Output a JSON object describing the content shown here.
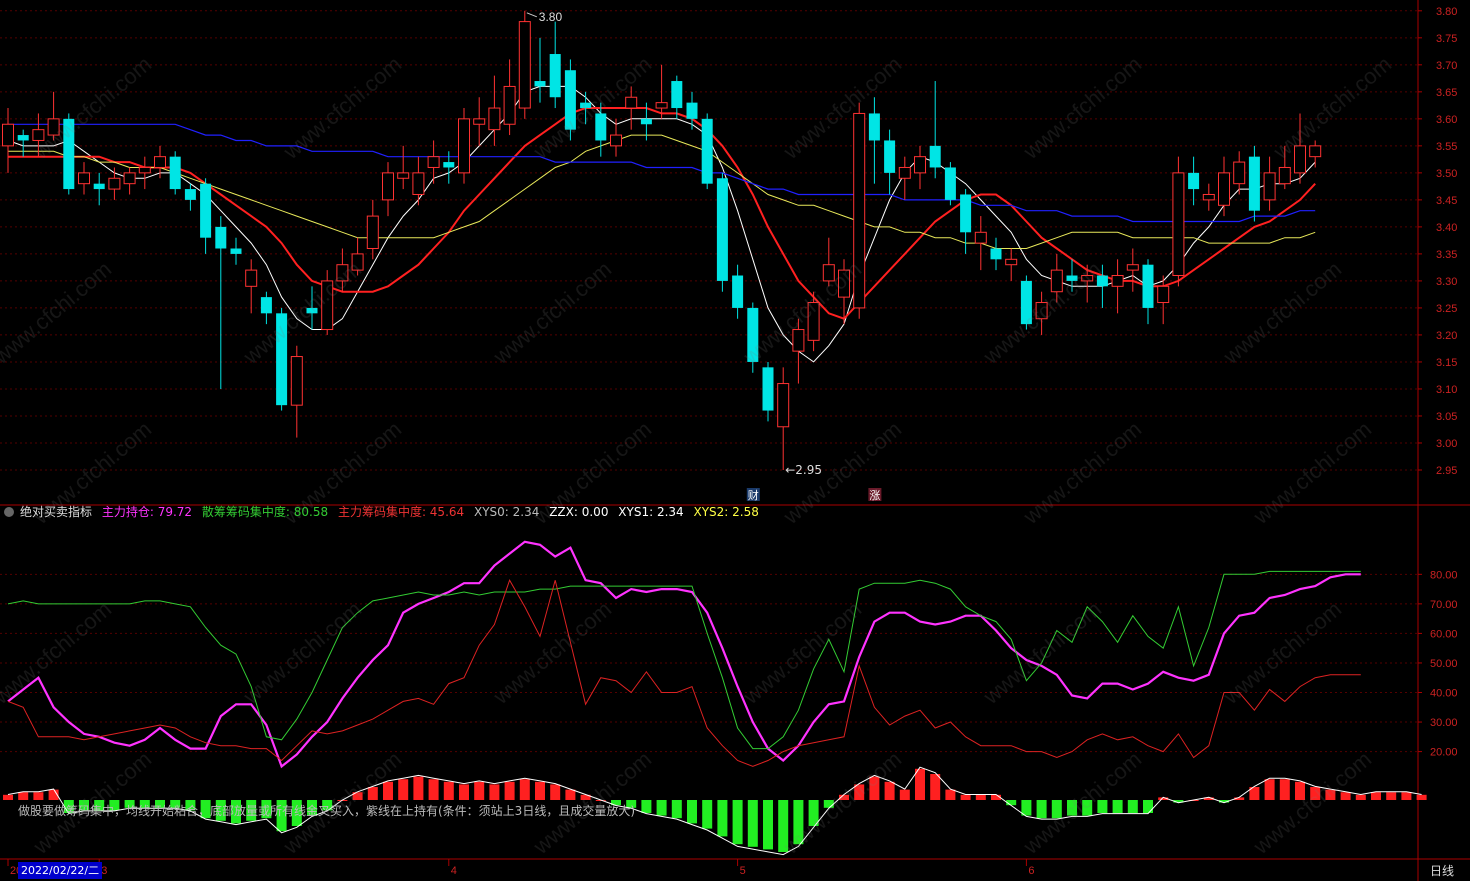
{
  "colors": {
    "up": "#ff3232",
    "down": "#00e5e5",
    "ma5": "#ffffff",
    "ma10": "#ff2020",
    "ma20": "#e8e85a",
    "ma60": "#2020ff",
    "main_hold": "#ff33ff",
    "retail": "#33cc33",
    "main_chip": "#dd2222",
    "xys2": "#ffff44",
    "axis": "#aa0000"
  },
  "price_axis": {
    "ticks": [
      "3.80",
      "3.75",
      "3.70",
      "3.65",
      "3.60",
      "3.55",
      "3.50",
      "3.45",
      "3.40",
      "3.35",
      "3.30",
      "3.25",
      "3.20",
      "3.15",
      "3.10",
      "3.05",
      "3.00",
      "2.95"
    ],
    "min": 2.9,
    "max": 3.82
  },
  "ind_axis": {
    "ticks": [
      "80.00",
      "70.00",
      "60.00",
      "50.00",
      "40.00",
      "30.00",
      "20.00"
    ],
    "min": 7,
    "max": 95
  },
  "x_axis": {
    "labels": [
      {
        "text": "20",
        "bar": 0
      },
      {
        "text": "3",
        "bar": 6
      },
      {
        "text": "4",
        "bar": 29
      },
      {
        "text": "5",
        "bar": 48
      },
      {
        "text": "6",
        "bar": 67
      }
    ]
  },
  "annotations": {
    "high_label": "3.80",
    "low_label": "2.95",
    "cai": "财",
    "zhang": "涨"
  },
  "indicator": {
    "name": "绝对买卖指标",
    "items": [
      {
        "label": "主力持仓: ",
        "value": "79.72",
        "color": "#ff33ff"
      },
      {
        "label": "散筹筹码集中度: ",
        "value": "80.58",
        "color": "#33cc33"
      },
      {
        "label": "主力筹码集中度: ",
        "value": "45.64",
        "color": "#dd2222"
      },
      {
        "label": "XYS0: ",
        "value": "2.34",
        "color": "#bbbbbb"
      },
      {
        "label": "ZZX: ",
        "value": "0.00",
        "color": "#ffffff"
      },
      {
        "label": "XYS1: ",
        "value": "2.34",
        "color": "#ffffff"
      },
      {
        "label": "XYS2: ",
        "value": "2.58",
        "color": "#ffff44"
      }
    ]
  },
  "hint_text": "做股要做筹码集中，均线开始粘合，底部放量或所有线金叉买入，紫线在上持有(条件：须站上3日线，且成交量放大)",
  "watermark": "www.cfchi.com",
  "date_badge": "2022/02/22/二",
  "period_label": "日线",
  "chart_data": {
    "type": "candlestick",
    "candles": [
      [
        3.55,
        3.59,
        3.62,
        3.5
      ],
      [
        3.57,
        3.56,
        3.58,
        3.53
      ],
      [
        3.56,
        3.58,
        3.61,
        3.53
      ],
      [
        3.57,
        3.6,
        3.65,
        3.56
      ],
      [
        3.6,
        3.47,
        3.61,
        3.46
      ],
      [
        3.48,
        3.5,
        3.52,
        3.46
      ],
      [
        3.48,
        3.47,
        3.5,
        3.44
      ],
      [
        3.47,
        3.49,
        3.51,
        3.45
      ],
      [
        3.48,
        3.5,
        3.51,
        3.46
      ],
      [
        3.5,
        3.51,
        3.53,
        3.47
      ],
      [
        3.51,
        3.53,
        3.55,
        3.49
      ],
      [
        3.53,
        3.47,
        3.54,
        3.46
      ],
      [
        3.47,
        3.45,
        3.48,
        3.43
      ],
      [
        3.48,
        3.38,
        3.49,
        3.35
      ],
      [
        3.4,
        3.36,
        3.42,
        3.1
      ],
      [
        3.36,
        3.35,
        3.38,
        3.33
      ],
      [
        3.29,
        3.32,
        3.34,
        3.24
      ],
      [
        3.27,
        3.24,
        3.28,
        3.22
      ],
      [
        3.24,
        3.07,
        3.25,
        3.06
      ],
      [
        3.07,
        3.16,
        3.18,
        3.01
      ],
      [
        3.25,
        3.24,
        3.29,
        3.21
      ],
      [
        3.21,
        3.3,
        3.32,
        3.2
      ],
      [
        3.3,
        3.33,
        3.36,
        3.28
      ],
      [
        3.32,
        3.35,
        3.38,
        3.31
      ],
      [
        3.36,
        3.42,
        3.45,
        3.34
      ],
      [
        3.45,
        3.5,
        3.52,
        3.42
      ],
      [
        3.49,
        3.5,
        3.55,
        3.47
      ],
      [
        3.46,
        3.5,
        3.53,
        3.44
      ],
      [
        3.51,
        3.53,
        3.56,
        3.48
      ],
      [
        3.52,
        3.51,
        3.54,
        3.48
      ],
      [
        3.5,
        3.6,
        3.62,
        3.48
      ],
      [
        3.59,
        3.6,
        3.64,
        3.55
      ],
      [
        3.58,
        3.62,
        3.68,
        3.55
      ],
      [
        3.59,
        3.66,
        3.71,
        3.57
      ],
      [
        3.62,
        3.78,
        3.8,
        3.6
      ],
      [
        3.67,
        3.66,
        3.75,
        3.63
      ],
      [
        3.72,
        3.64,
        3.78,
        3.62
      ],
      [
        3.69,
        3.58,
        3.71,
        3.56
      ],
      [
        3.63,
        3.62,
        3.65,
        3.59
      ],
      [
        3.61,
        3.56,
        3.63,
        3.53
      ],
      [
        3.55,
        3.57,
        3.6,
        3.53
      ],
      [
        3.62,
        3.64,
        3.66,
        3.58
      ],
      [
        3.6,
        3.59,
        3.63,
        3.56
      ],
      [
        3.62,
        3.63,
        3.7,
        3.6
      ],
      [
        3.67,
        3.62,
        3.68,
        3.6
      ],
      [
        3.63,
        3.6,
        3.65,
        3.58
      ],
      [
        3.6,
        3.48,
        3.61,
        3.47
      ],
      [
        3.49,
        3.3,
        3.5,
        3.28
      ],
      [
        3.31,
        3.25,
        3.33,
        3.23
      ],
      [
        3.25,
        3.15,
        3.26,
        3.13
      ],
      [
        3.14,
        3.06,
        3.15,
        3.04
      ],
      [
        3.03,
        3.11,
        3.14,
        2.95
      ],
      [
        3.17,
        3.21,
        3.23,
        3.11
      ],
      [
        3.19,
        3.26,
        3.28,
        3.17
      ],
      [
        3.3,
        3.33,
        3.38,
        3.29
      ],
      [
        3.27,
        3.32,
        3.34,
        3.22
      ],
      [
        3.25,
        3.61,
        3.63,
        3.23
      ],
      [
        3.61,
        3.56,
        3.64,
        3.48
      ],
      [
        3.56,
        3.5,
        3.58,
        3.46
      ],
      [
        3.49,
        3.51,
        3.53,
        3.45
      ],
      [
        3.5,
        3.53,
        3.55,
        3.47
      ],
      [
        3.55,
        3.51,
        3.67,
        3.49
      ],
      [
        3.51,
        3.45,
        3.52,
        3.44
      ],
      [
        3.46,
        3.39,
        3.47,
        3.35
      ],
      [
        3.37,
        3.39,
        3.42,
        3.32
      ],
      [
        3.36,
        3.34,
        3.38,
        3.32
      ],
      [
        3.33,
        3.34,
        3.36,
        3.3
      ],
      [
        3.3,
        3.22,
        3.31,
        3.21
      ],
      [
        3.23,
        3.26,
        3.28,
        3.2
      ],
      [
        3.28,
        3.32,
        3.35,
        3.26
      ],
      [
        3.31,
        3.3,
        3.34,
        3.28
      ],
      [
        3.3,
        3.31,
        3.33,
        3.26
      ],
      [
        3.31,
        3.29,
        3.33,
        3.25
      ],
      [
        3.29,
        3.31,
        3.34,
        3.24
      ],
      [
        3.32,
        3.33,
        3.36,
        3.28
      ],
      [
        3.33,
        3.25,
        3.34,
        3.22
      ],
      [
        3.26,
        3.29,
        3.31,
        3.22
      ],
      [
        3.31,
        3.5,
        3.53,
        3.29
      ],
      [
        3.5,
        3.47,
        3.53,
        3.44
      ],
      [
        3.45,
        3.46,
        3.48,
        3.43
      ],
      [
        3.44,
        3.5,
        3.53,
        3.42
      ],
      [
        3.48,
        3.52,
        3.54,
        3.46
      ],
      [
        3.53,
        3.43,
        3.55,
        3.41
      ],
      [
        3.45,
        3.5,
        3.53,
        3.43
      ],
      [
        3.48,
        3.51,
        3.55,
        3.47
      ],
      [
        3.5,
        3.55,
        3.61,
        3.48
      ],
      [
        3.53,
        3.55,
        3.56,
        3.51
      ]
    ],
    "ma_series": [
      {
        "name": "MA5",
        "values": [
          3.56,
          3.55,
          3.55,
          3.55,
          3.56,
          3.54,
          3.52,
          3.5,
          3.49,
          3.49,
          3.5,
          3.5,
          3.48,
          3.46,
          3.43,
          3.4,
          3.37,
          3.33,
          3.27,
          3.23,
          3.21,
          3.21,
          3.23,
          3.28,
          3.33,
          3.38,
          3.42,
          3.45,
          3.49,
          3.5,
          3.52,
          3.55,
          3.58,
          3.61,
          3.65,
          3.66,
          3.66,
          3.66,
          3.64,
          3.61,
          3.59,
          3.6,
          3.6,
          3.6,
          3.6,
          3.59,
          3.57,
          3.51,
          3.43,
          3.34,
          3.25,
          3.2,
          3.17,
          3.15,
          3.18,
          3.22,
          3.31,
          3.38,
          3.45,
          3.5,
          3.53,
          3.52,
          3.5,
          3.48,
          3.45,
          3.42,
          3.39,
          3.34,
          3.31,
          3.3,
          3.29,
          3.29,
          3.29,
          3.3,
          3.31,
          3.29,
          3.3,
          3.33,
          3.37,
          3.4,
          3.44,
          3.47,
          3.47,
          3.48,
          3.48,
          3.49,
          3.52
        ]
      },
      {
        "name": "MA10",
        "values": [
          3.53,
          3.53,
          3.53,
          3.53,
          3.53,
          3.53,
          3.53,
          3.52,
          3.52,
          3.51,
          3.51,
          3.51,
          3.5,
          3.48,
          3.46,
          3.44,
          3.42,
          3.4,
          3.37,
          3.33,
          3.3,
          3.29,
          3.28,
          3.28,
          3.28,
          3.29,
          3.31,
          3.33,
          3.36,
          3.39,
          3.43,
          3.46,
          3.49,
          3.52,
          3.55,
          3.57,
          3.59,
          3.61,
          3.62,
          3.62,
          3.62,
          3.62,
          3.62,
          3.61,
          3.61,
          3.6,
          3.58,
          3.55,
          3.51,
          3.46,
          3.4,
          3.35,
          3.3,
          3.27,
          3.24,
          3.23,
          3.26,
          3.29,
          3.32,
          3.35,
          3.38,
          3.41,
          3.43,
          3.45,
          3.46,
          3.46,
          3.44,
          3.41,
          3.38,
          3.36,
          3.34,
          3.32,
          3.31,
          3.3,
          3.3,
          3.29,
          3.29,
          3.3,
          3.32,
          3.34,
          3.36,
          3.38,
          3.4,
          3.41,
          3.43,
          3.45,
          3.48
        ]
      },
      {
        "name": "MA20",
        "values": [
          3.54,
          3.54,
          3.54,
          3.54,
          3.53,
          3.53,
          3.52,
          3.52,
          3.51,
          3.51,
          3.51,
          3.5,
          3.49,
          3.48,
          3.47,
          3.46,
          3.45,
          3.44,
          3.43,
          3.42,
          3.41,
          3.4,
          3.39,
          3.38,
          3.38,
          3.38,
          3.38,
          3.38,
          3.38,
          3.39,
          3.4,
          3.41,
          3.43,
          3.45,
          3.47,
          3.49,
          3.51,
          3.52,
          3.54,
          3.55,
          3.56,
          3.57,
          3.57,
          3.57,
          3.56,
          3.55,
          3.54,
          3.52,
          3.5,
          3.48,
          3.46,
          3.45,
          3.44,
          3.44,
          3.43,
          3.42,
          3.41,
          3.4,
          3.4,
          3.39,
          3.39,
          3.38,
          3.38,
          3.37,
          3.37,
          3.36,
          3.36,
          3.36,
          3.37,
          3.38,
          3.39,
          3.39,
          3.39,
          3.39,
          3.38,
          3.38,
          3.38,
          3.38,
          3.38,
          3.37,
          3.37,
          3.37,
          3.37,
          3.37,
          3.38,
          3.38,
          3.39
        ]
      },
      {
        "name": "MA60",
        "values": [
          3.59,
          3.59,
          3.59,
          3.59,
          3.59,
          3.59,
          3.59,
          3.59,
          3.59,
          3.59,
          3.59,
          3.59,
          3.58,
          3.57,
          3.57,
          3.56,
          3.56,
          3.55,
          3.55,
          3.55,
          3.54,
          3.54,
          3.54,
          3.54,
          3.54,
          3.53,
          3.53,
          3.53,
          3.53,
          3.53,
          3.53,
          3.53,
          3.53,
          3.53,
          3.53,
          3.53,
          3.52,
          3.52,
          3.52,
          3.52,
          3.52,
          3.52,
          3.51,
          3.51,
          3.51,
          3.51,
          3.5,
          3.5,
          3.49,
          3.48,
          3.47,
          3.47,
          3.46,
          3.46,
          3.46,
          3.46,
          3.46,
          3.46,
          3.46,
          3.45,
          3.45,
          3.45,
          3.45,
          3.45,
          3.44,
          3.44,
          3.44,
          3.43,
          3.43,
          3.43,
          3.42,
          3.42,
          3.42,
          3.42,
          3.41,
          3.41,
          3.41,
          3.41,
          3.41,
          3.41,
          3.41,
          3.41,
          3.42,
          3.42,
          3.42,
          3.43,
          3.43
        ]
      }
    ],
    "indicator_series": [
      {
        "name": "主力持仓",
        "values": [
          37,
          41,
          45,
          35,
          30,
          26,
          25,
          23,
          22,
          24,
          28,
          24,
          21,
          21,
          32,
          36,
          36,
          29,
          15,
          19,
          25,
          30,
          38,
          45,
          51,
          56,
          67,
          70,
          72,
          74,
          77,
          77,
          83,
          87,
          91,
          90,
          86,
          89,
          78,
          77,
          72,
          75,
          74,
          75,
          75,
          74,
          67,
          55,
          42,
          30,
          21,
          17,
          22,
          30,
          36,
          37,
          52,
          64,
          67,
          67,
          64,
          63,
          64,
          66,
          66,
          61,
          55,
          51,
          49,
          46,
          39,
          38,
          43,
          43,
          41,
          43,
          47,
          45,
          44,
          46,
          60,
          66,
          67,
          72,
          73,
          75,
          76,
          79,
          80,
          80
        ]
      },
      {
        "name": "散筹筹码集中度",
        "values": [
          70,
          71,
          70,
          70,
          70,
          70,
          70,
          70,
          70,
          71,
          71,
          70,
          69,
          62,
          56,
          53,
          42,
          25,
          24,
          31,
          40,
          51,
          62,
          67,
          71,
          72,
          73,
          74,
          73,
          73,
          74,
          73,
          74,
          74,
          74,
          75,
          75,
          76,
          76,
          76,
          76,
          76,
          76,
          76,
          76,
          76,
          60,
          45,
          28,
          21,
          21,
          25,
          34,
          48,
          58,
          47,
          75,
          77,
          77,
          77,
          78,
          77,
          75,
          69,
          66,
          64,
          58,
          44,
          50,
          61,
          57,
          69,
          64,
          57,
          66,
          59,
          55,
          69,
          49,
          62,
          80,
          80,
          80,
          81,
          81,
          81,
          81,
          81,
          81,
          81
        ]
      },
      {
        "name": "主力筹码集中度",
        "values": [
          37,
          35,
          25,
          25,
          25,
          24,
          25,
          26,
          27,
          28,
          29,
          28,
          25,
          23,
          22,
          22,
          21,
          21,
          17,
          22,
          27,
          26,
          27,
          29,
          31,
          34,
          37,
          38,
          36,
          43,
          45,
          56,
          63,
          78,
          69,
          59,
          78,
          57,
          36,
          45,
          44,
          40,
          47,
          40,
          40,
          42,
          28,
          22,
          17,
          15,
          17,
          20,
          22,
          23,
          24,
          25,
          49,
          35,
          29,
          32,
          34,
          28,
          30,
          25,
          22,
          22,
          22,
          20,
          20,
          18,
          20,
          24,
          26,
          24,
          25,
          22,
          20,
          26,
          18,
          22,
          40,
          40,
          34,
          41,
          37,
          42,
          45,
          46,
          46,
          46
        ]
      }
    ],
    "histogram": [
      2,
      3,
      3,
      4,
      -5,
      -4,
      -4,
      -4,
      -3,
      -3,
      -3,
      -3,
      -4,
      -7,
      -8,
      -9,
      -8,
      -7,
      -12,
      -10,
      -6,
      -4,
      0,
      3,
      5,
      7,
      8,
      9,
      8,
      7,
      6,
      7,
      6,
      7,
      8,
      7,
      6,
      4,
      2,
      0,
      -2,
      -3,
      -5,
      -6,
      -7,
      -9,
      -11,
      -14,
      -17,
      -18,
      -19,
      -20,
      -17,
      -10,
      -3,
      2,
      6,
      9,
      7,
      4,
      12,
      10,
      4,
      2,
      2,
      2,
      -2,
      -6,
      -7,
      -7,
      -6,
      -6,
      -5,
      -5,
      -5,
      -5,
      1,
      -1,
      0,
      1,
      -1,
      1,
      5,
      8,
      8,
      7,
      5,
      4,
      3,
      2,
      3,
      3,
      3,
      2
    ]
  }
}
